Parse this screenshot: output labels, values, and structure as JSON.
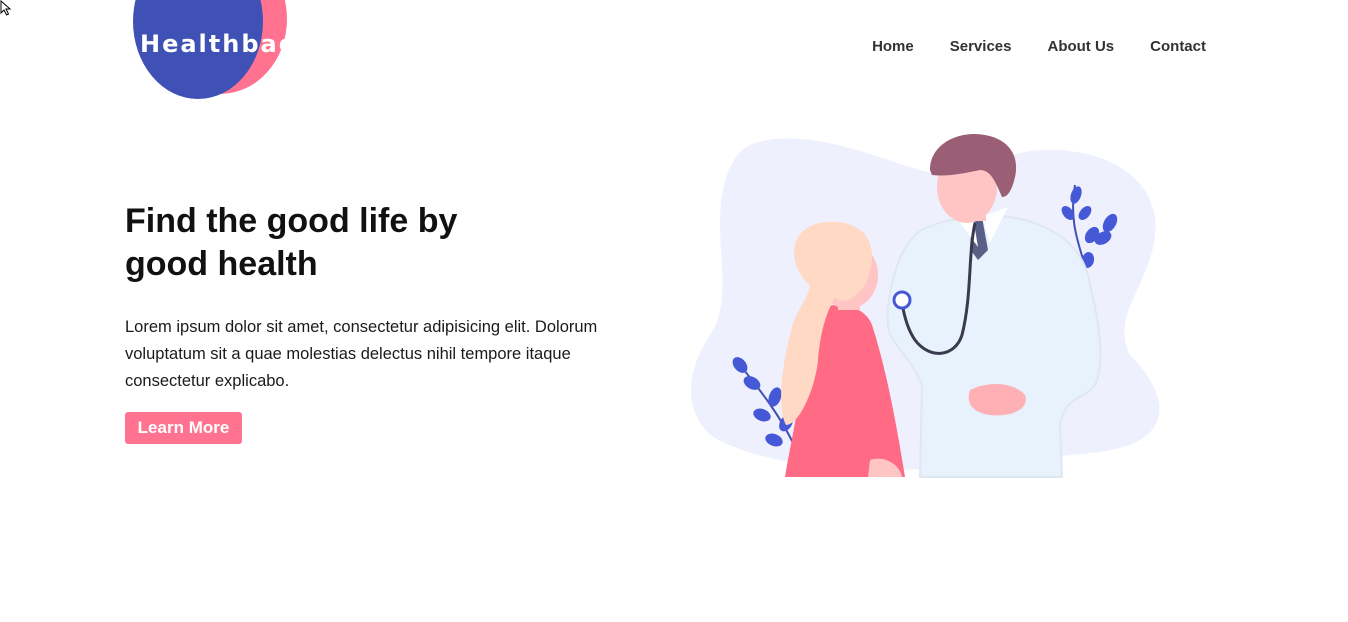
{
  "header": {
    "logo_text": "Healthbag",
    "nav": [
      {
        "label": "Home"
      },
      {
        "label": "Services"
      },
      {
        "label": "About Us"
      },
      {
        "label": "Contact"
      }
    ]
  },
  "hero": {
    "title": "Find the good life by good health",
    "description": "Lorem ipsum dolor sit amet, consectetur adipisicing elit. Dolorum voluptatum sit a quae molestias delectus nihil tempore itaque consectetur explicabo.",
    "cta_label": "Learn More"
  },
  "colors": {
    "brand_blue": "#3f51b5",
    "brand_pink": "#ff7390",
    "illustration_bg": "#eef0fd"
  },
  "illustration": {
    "icon": "doctor-patient-illustration"
  }
}
